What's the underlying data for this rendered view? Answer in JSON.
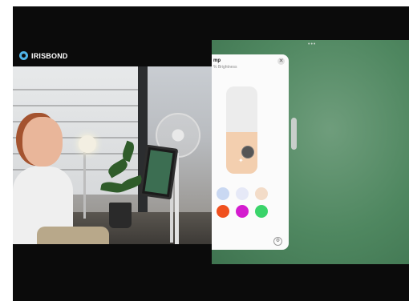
{
  "brand": {
    "name": "IRISBOND",
    "icon": "irisbond-eye-icon"
  },
  "ipad": {
    "top_indicator": "•••",
    "panel": {
      "title": "mp",
      "subtitle": "% Brightness",
      "close_icon": "close-icon",
      "brightness_fraction": 0.48,
      "colors": {
        "row1": [
          "#c9d8f2",
          "#e6e9f7",
          "#f3dcc8"
        ],
        "row2": [
          "#f0501e",
          "#d41ccf",
          "#3ad46a"
        ]
      },
      "settings_icon": "gear-icon"
    }
  }
}
